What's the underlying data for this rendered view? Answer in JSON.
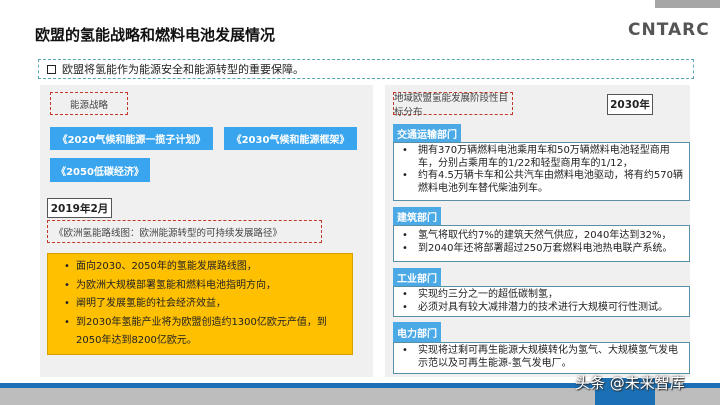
{
  "header": {
    "title": "欧盟的氢能战略和燃料电池发展情况",
    "logo": "CNTARC"
  },
  "top_note": "欧盟将氢能作为能源安全和能源转型的重要保障。",
  "left": {
    "label": "能源战略",
    "plans": [
      "《2020气候和能源一揽子计划》",
      "《2030气候和能源框架》",
      "《2050低碳经济》"
    ],
    "date": "2019年2月",
    "roadmap": "《欧洲氢能路线图：欧洲能源转型的可持续发展路径》",
    "bullets": [
      "面向2030、2050年的氢能发展路线图，",
      "为欧洲大规模部署氢能和燃料电池指明方向，",
      "阐明了发展氢能的社会经济效益，",
      "到2030年氢能产业将为欧盟创造约1300亿欧元产值，到2050年达到8200亿欧元。"
    ]
  },
  "right": {
    "label": "地域欧盟氢能发展阶段性目标分布",
    "year": "2030年",
    "sectors": [
      {
        "name": "交通运输部门",
        "items": [
          "拥有370万辆燃料电池乘用车和50万辆燃料电池轻型商用车，分别占乘用车的1/22和轻型商用车的1/12，",
          "约有4.5万辆卡车和公共汽车由燃料电池驱动，将有约570辆燃料电池列车替代柴油列车。"
        ]
      },
      {
        "name": "建筑部门",
        "items": [
          "氢气将取代约7%的建筑天然气供应，2040年达到32%，",
          "到2040年还将部署超过250万套燃料电池热电联产系统。"
        ]
      },
      {
        "name": "工业部门",
        "items": [
          "实现约三分之一的超低碳制氢，",
          "必须对具有较大减排潜力的技术进行大规模可行性测试。"
        ]
      },
      {
        "name": "电力部门",
        "items": [
          "实现将过剩可再生能源大规模转化为氢气、大规模氢气发电示范以及可再生能源-氢气发电厂。"
        ]
      }
    ]
  },
  "watermark": "头条 @未来智库"
}
